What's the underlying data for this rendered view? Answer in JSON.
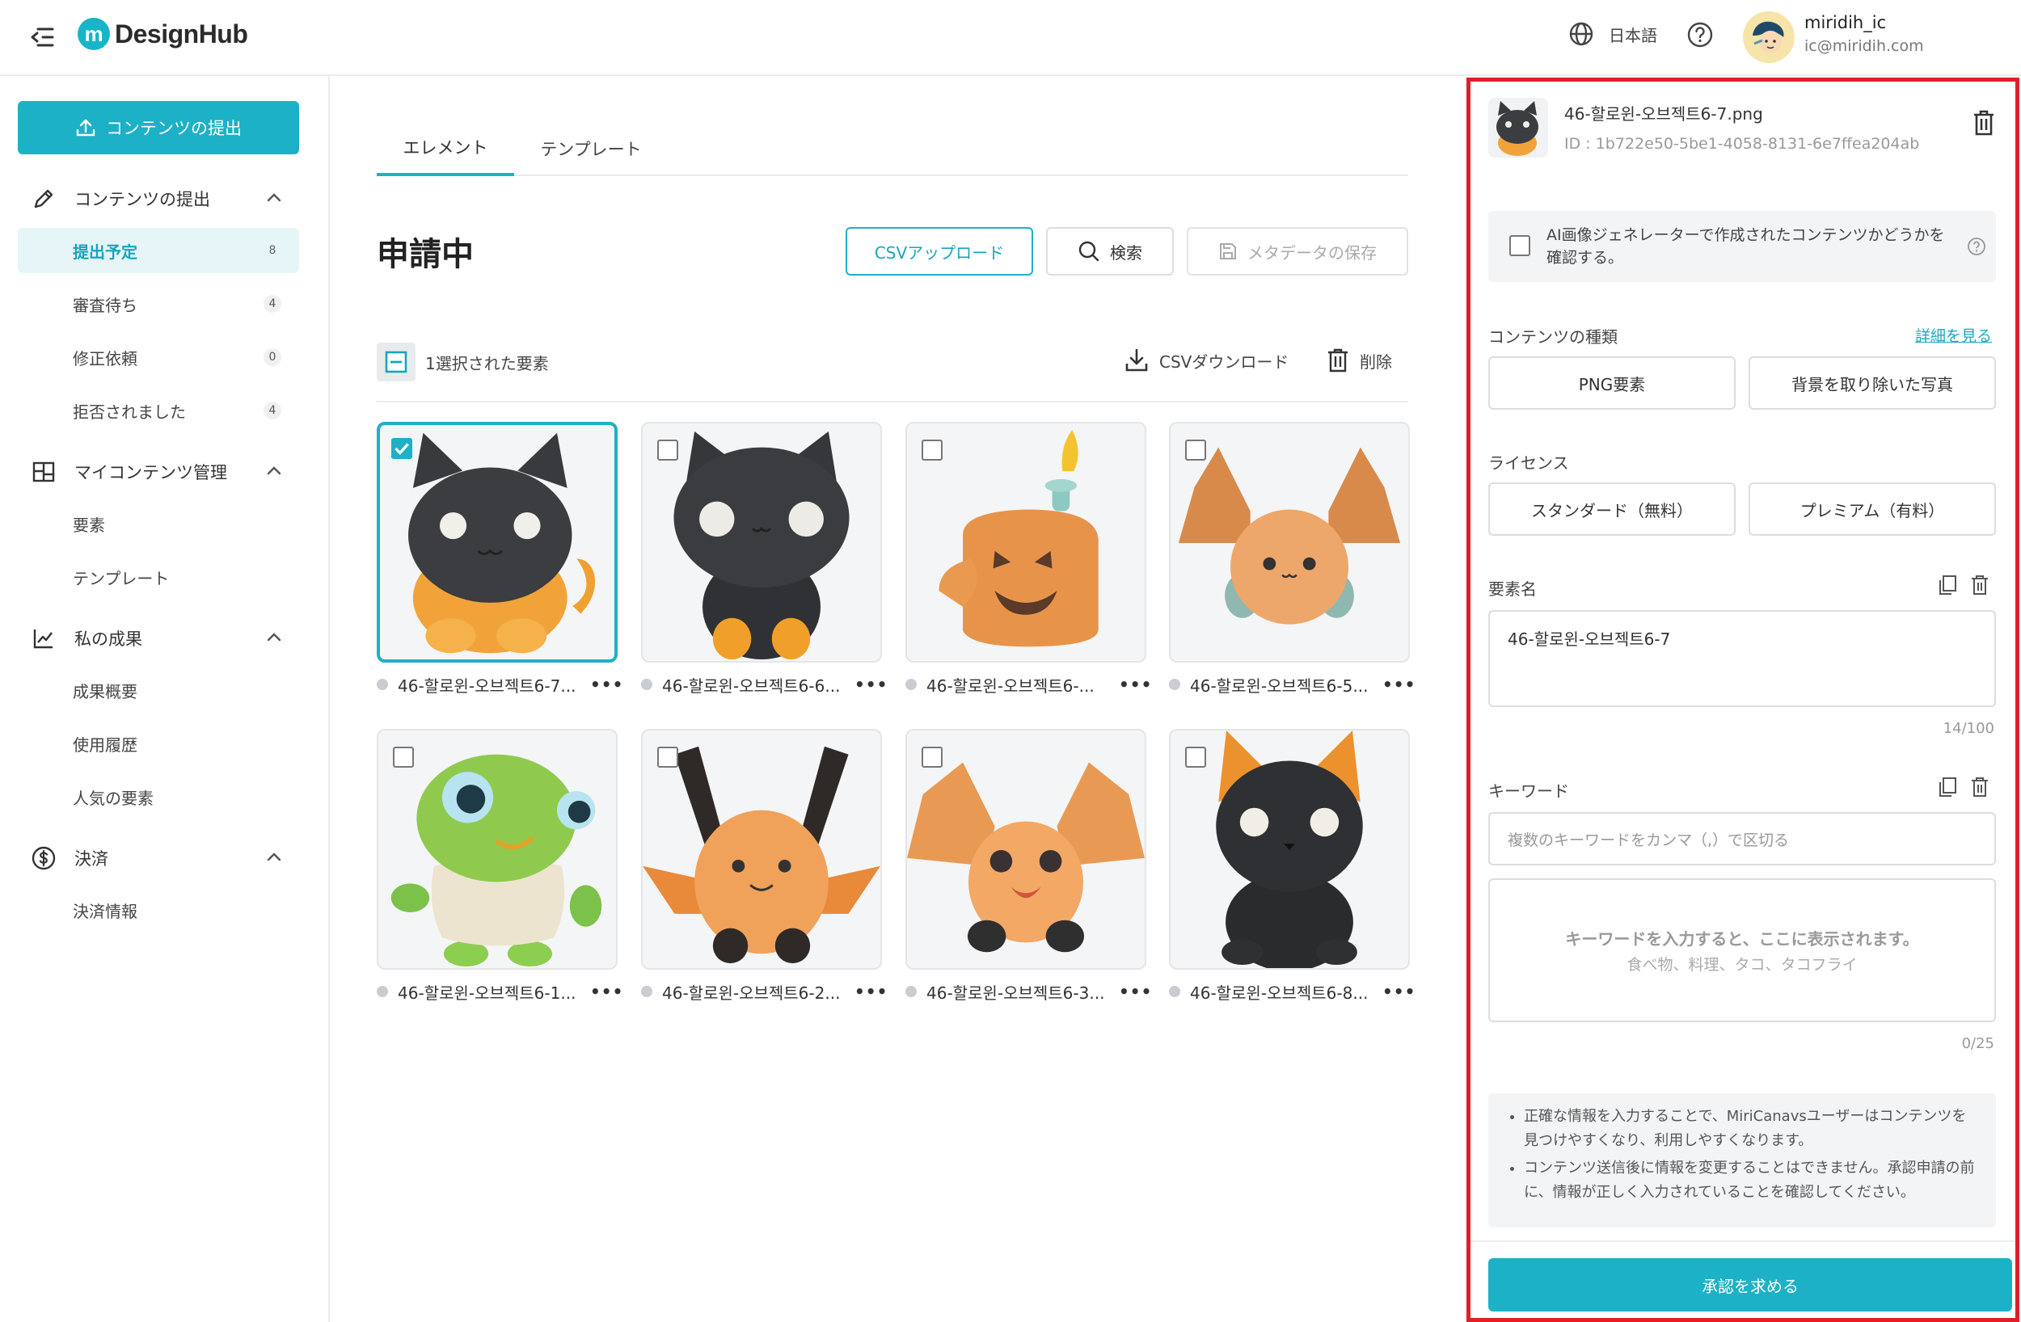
{
  "header": {
    "logo_mark": "m",
    "logo_text": "DesignHub",
    "language": "日本語",
    "user_name": "miridih_ic",
    "user_email": "ic@miridih.com"
  },
  "sidebar": {
    "submit_button": "コンテンツの提出",
    "sections": [
      {
        "label": "コンテンツの提出",
        "icon": "pencil-icon"
      },
      {
        "label": "マイコンテンツ管理",
        "icon": "layout-icon"
      },
      {
        "label": "私の成果",
        "icon": "chart-icon"
      },
      {
        "label": "決済",
        "icon": "dollar-icon"
      }
    ],
    "items": [
      {
        "label": "提出予定",
        "count": "8",
        "active": true
      },
      {
        "label": "審査待ち",
        "count": "4"
      },
      {
        "label": "修正依頼",
        "count": "0"
      },
      {
        "label": "拒否されました",
        "count": "4"
      },
      {
        "label": "要素"
      },
      {
        "label": "テンプレート"
      },
      {
        "label": "成果概要"
      },
      {
        "label": "使用履歴"
      },
      {
        "label": "人気の要素"
      },
      {
        "label": "決済情報"
      }
    ]
  },
  "main": {
    "tabs": [
      "エレメント",
      "テンプレート"
    ],
    "title": "申請中",
    "csv_upload": "CSVアップロード",
    "search": "検索",
    "save_metadata": "メタデータの保存",
    "selected_label": "1選択された要素",
    "csv_download": "CSVダウンロード",
    "delete": "削除",
    "cards": [
      {
        "name": "46-할로윈-오브젝트6-7...",
        "selected": true
      },
      {
        "name": "46-할로윈-오브젝트6-6..."
      },
      {
        "name": "46-할로윈-오브젝트6-..."
      },
      {
        "name": "46-할로윈-오브젝트6-5..."
      },
      {
        "name": "46-할로윈-오브젝트6-1..."
      },
      {
        "name": "46-할로윈-오브젝트6-2..."
      },
      {
        "name": "46-할로윈-오브젝트6-3..."
      },
      {
        "name": "46-할로윈-오브젝트6-8..."
      }
    ]
  },
  "panel": {
    "file_name": "46-할로윈-오브젝트6-7.png",
    "file_id": "ID : 1b722e50-5be1-4058-8131-6e7ffea204ab",
    "ai_label": "AI画像ジェネレーターで作成されたコンテンツかどうかを確認する。",
    "content_type_label": "コンテンツの種類",
    "details_link": "詳細を見る",
    "type_options": [
      "PNG要素",
      "背景を取り除いた写真"
    ],
    "license_label": "ライセンス",
    "license_options": [
      "スタンダード（無料）",
      "プレミアム（有料）"
    ],
    "element_name_label": "要素名",
    "element_name_value": "46-할로윈-오브젝트6-7",
    "element_name_counter": "14/100",
    "keyword_label": "キーワード",
    "keyword_placeholder": "複数のキーワードをカンマ（,）で区切る",
    "keyword_hint_main": "キーワードを入力すると、ここに表示されます。",
    "keyword_hint_sub": "食べ物、料理、タコ、タコフライ",
    "keyword_counter": "0/25",
    "notes": [
      "正確な情報を入力することで、MiriCanavsユーザーはコンテンツを見つけやすくなり、利用しやすくなります。",
      "コンテンツ送信後に情報を変更することはできません。承認申請の前に、情報が正しく入力されていることを確認してください。"
    ],
    "approve_button": "承認を求める"
  },
  "colors": {
    "accent": "#1db1c7",
    "highlight_border": "#e21e2a"
  }
}
